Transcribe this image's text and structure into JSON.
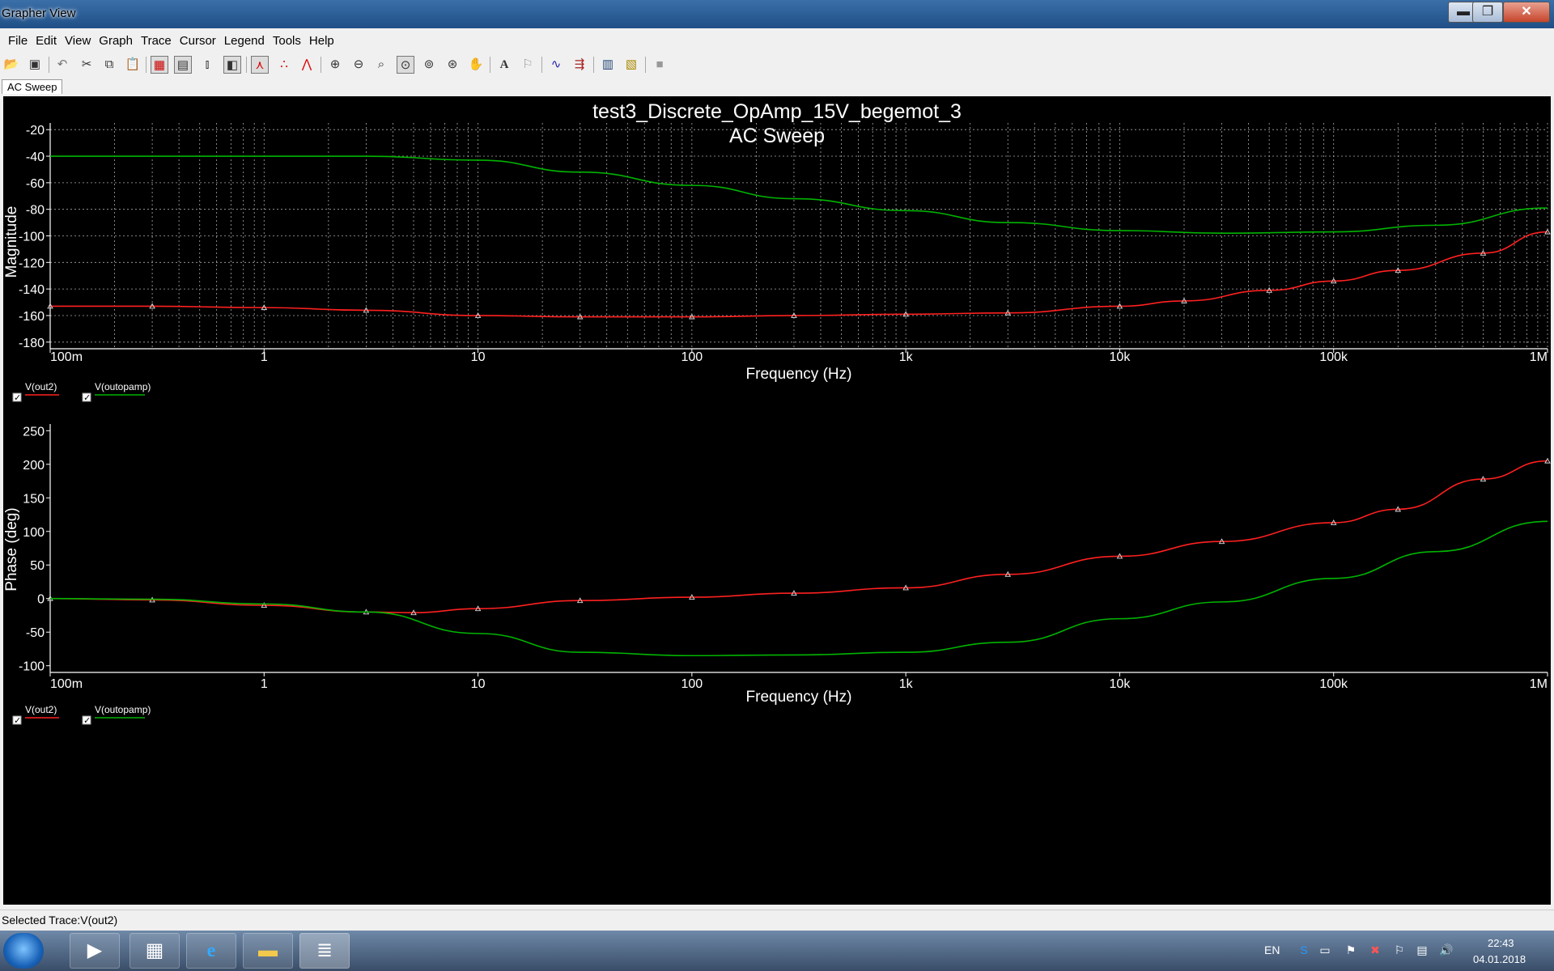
{
  "window": {
    "title": "Grapher View",
    "minimize": "▬",
    "maximize": "❐",
    "close": "✕"
  },
  "menu": [
    "File",
    "Edit",
    "View",
    "Graph",
    "Trace",
    "Cursor",
    "Legend",
    "Tools",
    "Help"
  ],
  "toolbar": {
    "icons": [
      "open-icon",
      "save-icon",
      "undo-icon",
      "cut-icon",
      "copy-icon",
      "paste-icon",
      "grid-icon",
      "legend-icon",
      "select-marks-icon",
      "invert-colors-icon",
      "show-cursors-icon",
      "data-markers-icon",
      "data-points-icon",
      "zoom-in-icon",
      "zoom-out-icon",
      "zoom-area-icon",
      "zoom-full-icon",
      "zoom-x-icon",
      "zoom-y-icon",
      "pan-icon",
      "text-icon",
      "label-icon",
      "overlay-traces-icon",
      "export-icon",
      "copy-graph-icon",
      "paste-graph-icon",
      "stop-icon"
    ]
  },
  "tabs": [
    {
      "label": "AC Sweep"
    }
  ],
  "graph": {
    "title": "test3_Discrete_OpAmp_15V_begemot_3",
    "subtitle": "AC Sweep"
  },
  "chart_data": [
    {
      "type": "line",
      "xlabel": "Frequency (Hz)",
      "ylabel": "Magnitude",
      "x_scale": "log",
      "xlim": [
        0.1,
        1000000
      ],
      "ylim": [
        -185,
        -15
      ],
      "x_ticks": [
        0.1,
        1,
        10,
        100,
        1000,
        10000,
        100000,
        1000000
      ],
      "x_tick_labels": [
        "100m",
        "1",
        "10",
        "100",
        "1k",
        "10k",
        "100k",
        "1M"
      ],
      "y_ticks": [
        -20,
        -40,
        -60,
        -80,
        -100,
        -120,
        -140,
        -160,
        -180
      ],
      "y_tick_labels": [
        "-20",
        "-40",
        "-60",
        "-80",
        "-100",
        "-120",
        "-140",
        "-160",
        "-180"
      ],
      "grid": true,
      "series": [
        {
          "name": "V(out2)",
          "color": "#ff2020",
          "markers": true,
          "x": [
            0.1,
            0.3,
            1,
            3,
            10,
            30,
            100,
            300,
            1000,
            3000,
            10000,
            20000,
            50000,
            100000,
            200000,
            500000,
            1000000
          ],
          "y": [
            -153,
            -153,
            -154,
            -156,
            -160,
            -161,
            -161,
            -160,
            -159,
            -158,
            -153,
            -149,
            -141,
            -134,
            -126,
            -113,
            -97
          ]
        },
        {
          "name": "V(outopamp)",
          "color": "#00b400",
          "markers": false,
          "x": [
            0.1,
            1,
            3,
            10,
            30,
            100,
            300,
            1000,
            3000,
            10000,
            30000,
            100000,
            300000,
            1000000
          ],
          "y": [
            -40,
            -40,
            -40,
            -43,
            -52,
            -62,
            -72,
            -81,
            -90,
            -96,
            -98,
            -97,
            -92,
            -79
          ]
        }
      ]
    },
    {
      "type": "line",
      "xlabel": "Frequency (Hz)",
      "ylabel": "Phase (deg)",
      "x_scale": "log",
      "xlim": [
        0.1,
        1000000
      ],
      "ylim": [
        -110,
        260
      ],
      "x_ticks": [
        0.1,
        1,
        10,
        100,
        1000,
        10000,
        100000,
        1000000
      ],
      "x_tick_labels": [
        "100m",
        "1",
        "10",
        "100",
        "1k",
        "10k",
        "100k",
        "1M"
      ],
      "y_ticks": [
        250,
        200,
        150,
        100,
        50,
        0,
        -50,
        -100
      ],
      "y_tick_labels": [
        "250",
        "200",
        "150",
        "100",
        "50",
        "0",
        "-50",
        "-100"
      ],
      "grid": false,
      "series": [
        {
          "name": "V(out2)",
          "color": "#ff2020",
          "markers": true,
          "x": [
            0.1,
            0.3,
            1,
            3,
            5,
            10,
            30,
            100,
            300,
            1000,
            3000,
            10000,
            30000,
            100000,
            200000,
            500000,
            1000000
          ],
          "y": [
            0,
            -2,
            -10,
            -20,
            -21,
            -15,
            -3,
            2,
            8,
            16,
            36,
            63,
            85,
            113,
            133,
            178,
            205
          ]
        },
        {
          "name": "V(outopamp)",
          "color": "#00b400",
          "markers": false,
          "x": [
            0.1,
            0.3,
            1,
            3,
            10,
            30,
            100,
            300,
            1000,
            3000,
            10000,
            30000,
            100000,
            300000,
            1000000
          ],
          "y": [
            0,
            -1,
            -8,
            -20,
            -52,
            -80,
            -85,
            -84,
            -80,
            -65,
            -30,
            -5,
            30,
            70,
            115
          ]
        }
      ]
    }
  ],
  "legend": {
    "items": [
      {
        "label": "V(out2)",
        "color": "#ff2020"
      },
      {
        "label": "V(outopamp)",
        "color": "#00b400"
      }
    ]
  },
  "status": {
    "text": "Selected Trace:V(out2)"
  },
  "taskbar": {
    "lang": "EN",
    "time": "22:43",
    "date": "04.01.2018"
  }
}
